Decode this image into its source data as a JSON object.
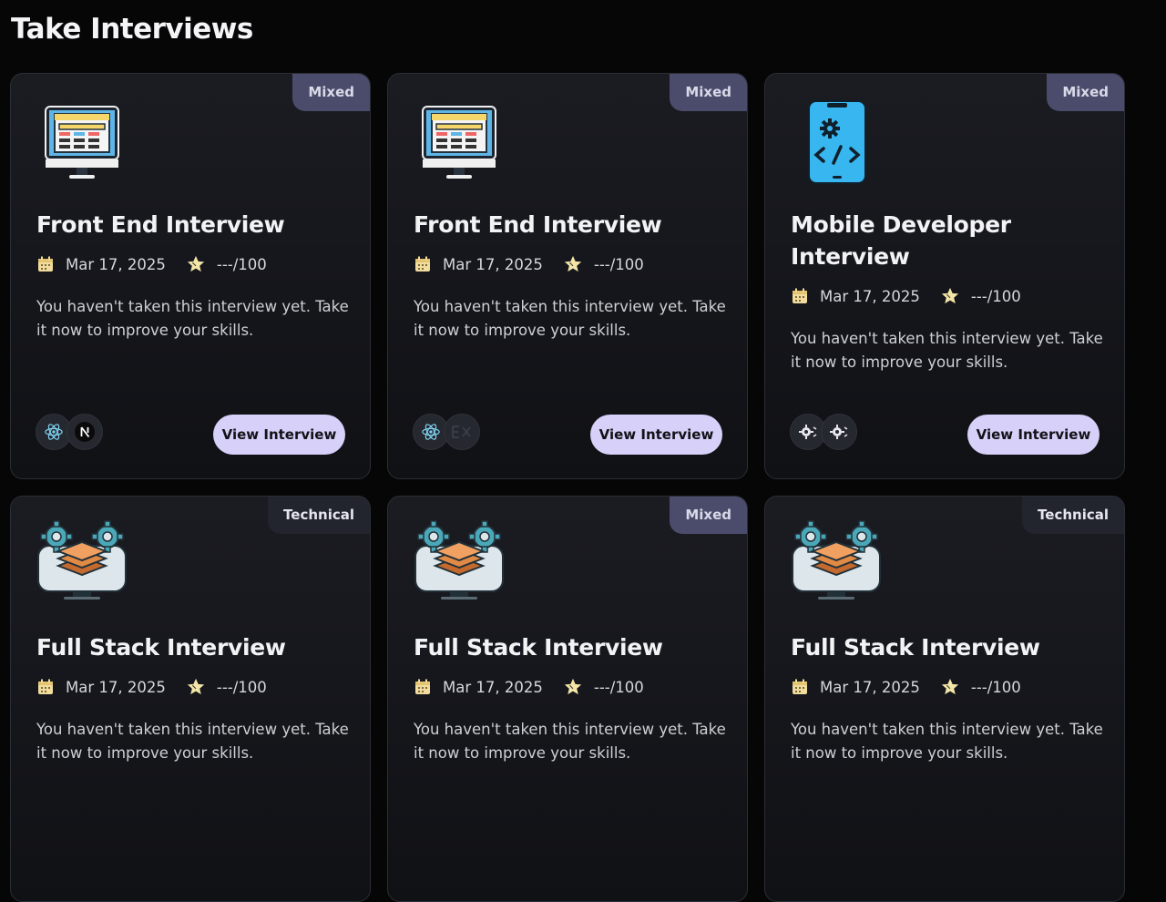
{
  "page": {
    "title": "Take Interviews"
  },
  "cards": [
    {
      "badge": "Mixed",
      "badge_kind": "mixed",
      "icon": "monitor-layout-icon",
      "title": "Front End Interview",
      "date": "Mar 17, 2025",
      "score": "---/100",
      "description": "You haven't taken this interview yet. Take it now to improve your skills.",
      "techs": [
        "react-icon",
        "nextjs-icon"
      ],
      "button": "View Interview"
    },
    {
      "badge": "Mixed",
      "badge_kind": "mixed",
      "icon": "monitor-layout-icon",
      "title": "Front End Interview",
      "date": "Mar 17, 2025",
      "score": "---/100",
      "description": "You haven't taken this interview yet. Take it now to improve your skills.",
      "techs": [
        "react-icon",
        "express-icon"
      ],
      "button": "View Interview"
    },
    {
      "badge": "Mixed",
      "badge_kind": "mixed",
      "icon": "mobile-code-icon",
      "title": "Mobile Developer Interview",
      "date": "Mar 17, 2025",
      "score": "---/100",
      "description": "You haven't taken this interview yet. Take it now to improve your skills.",
      "techs": [
        "gear-code-icon",
        "gear-code-icon"
      ],
      "button": "View Interview"
    },
    {
      "badge": "Technical",
      "badge_kind": "technical",
      "icon": "fullstack-layers-icon",
      "title": "Full Stack Interview",
      "date": "Mar 17, 2025",
      "score": "---/100",
      "description": "You haven't taken this interview yet. Take it now to improve your skills."
    },
    {
      "badge": "Mixed",
      "badge_kind": "mixed",
      "icon": "fullstack-layers-icon",
      "title": "Full Stack Interview",
      "date": "Mar 17, 2025",
      "score": "---/100",
      "description": "You haven't taken this interview yet. Take it now to improve your skills."
    },
    {
      "badge": "Technical",
      "badge_kind": "technical",
      "icon": "fullstack-layers-icon",
      "title": "Full Stack Interview",
      "date": "Mar 17, 2025",
      "score": "---/100",
      "description": "You haven't taken this interview yet. Take it now to improve your skills."
    }
  ],
  "colors": {
    "background": "#060607",
    "card": "#16171c",
    "mixed_badge": "#4b4c6c",
    "technical_badge": "#22242e",
    "button": "#d7d0f8"
  }
}
